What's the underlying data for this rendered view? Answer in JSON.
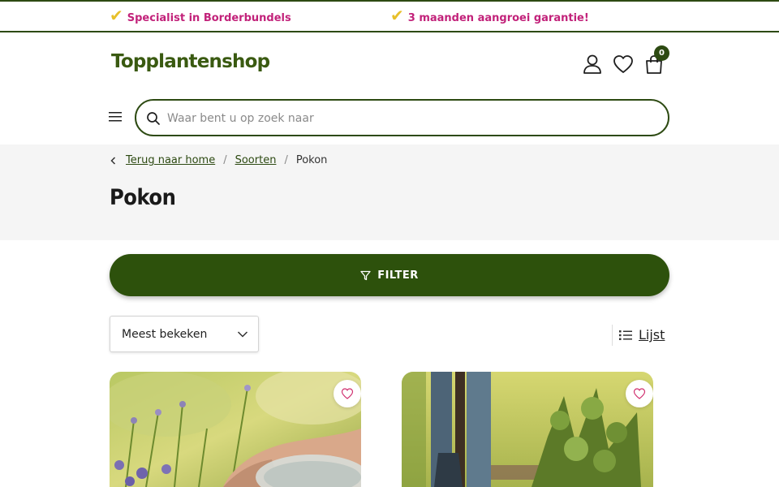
{
  "usp_bar": {
    "items": [
      {
        "check_icon": "check-icon",
        "text": "Specialist in Borderbundels"
      },
      {
        "check_icon": "check-icon",
        "text": "3 maanden aangroei garantie!"
      }
    ]
  },
  "header": {
    "logo_text": "Topplantenshop",
    "account_icon": "user-icon",
    "wishlist_icon": "heart-icon",
    "cart_icon": "shopping-bag-icon",
    "cart_count": "0",
    "menu_icon": "hamburger-icon",
    "search": {
      "icon": "search-icon",
      "placeholder": "Waar bent u op zoek naar"
    }
  },
  "breadcrumb": {
    "back_icon": "chevron-left-icon",
    "items": [
      "Terug naar home",
      "Soorten",
      "Pokon"
    ],
    "separator": "/"
  },
  "page": {
    "title": "Pokon"
  },
  "toolbar": {
    "filter_label": "FILTER",
    "filter_icon": "funnel-icon",
    "sort_selected": "Meest bekeken",
    "sort_icon": "chevron-down-icon",
    "view_label": "Lijst",
    "view_icon": "list-icon"
  },
  "products": [
    {
      "image": "hands-in-garden-with-flowers",
      "favorite_icon": "heart-outline-icon"
    },
    {
      "image": "gardener-boots-with-shrub",
      "favorite_icon": "heart-outline-icon"
    }
  ],
  "colors": {
    "brand_green": "#2d510c",
    "usp_pink": "#c2227a",
    "check_yellow": "#e7c02a",
    "fav_pink": "#d0306f"
  }
}
